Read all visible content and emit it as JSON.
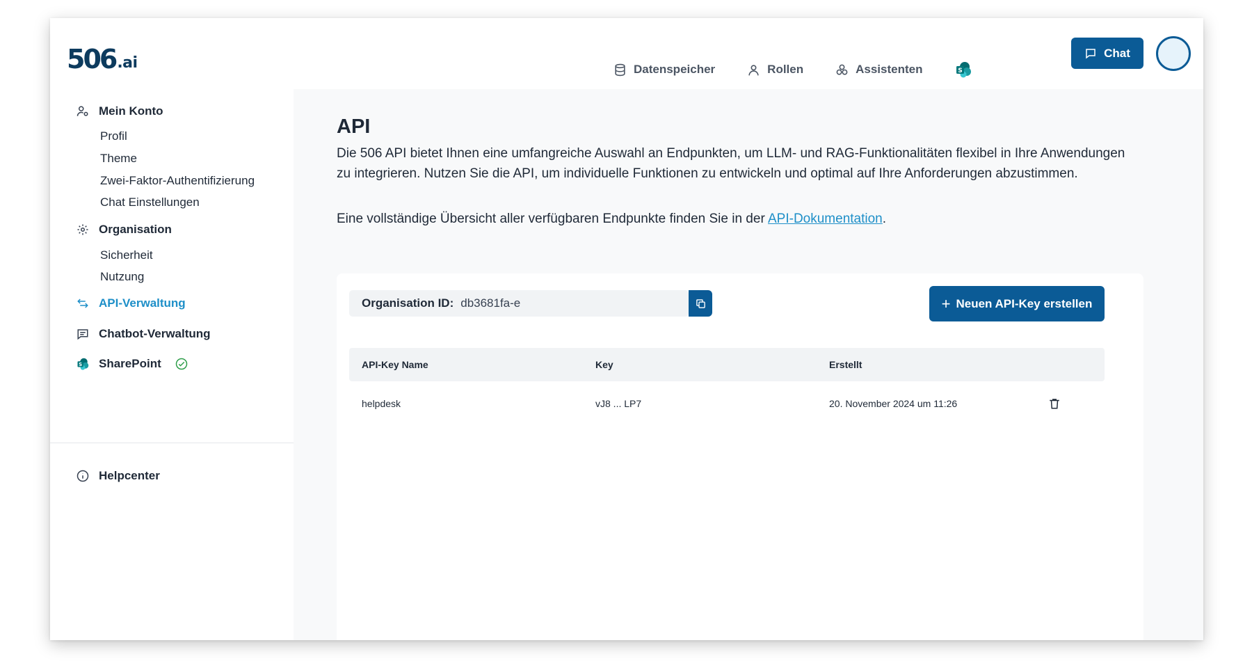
{
  "header": {
    "logo_number": "506",
    "logo_domain": ".ai",
    "nav": [
      {
        "label": "Datenspeicher",
        "icon": "database-icon"
      },
      {
        "label": "Rollen",
        "icon": "user-icon"
      },
      {
        "label": "Assistenten",
        "icon": "assistants-icon"
      }
    ],
    "sharepoint_icon": "sharepoint-icon",
    "chat_label": "Chat"
  },
  "sidebar": {
    "mein_konto": "Mein Konto",
    "profil": "Profil",
    "theme": "Theme",
    "zwei_faktor": "Zwei-Faktor-Authentifizierung",
    "chat_einstellungen": "Chat Einstellungen",
    "organisation": "Organisation",
    "sicherheit": "Sicherheit",
    "nutzung": "Nutzung",
    "api_verwaltung": "API-Verwaltung",
    "chatbot_verwaltung": "Chatbot-Verwaltung",
    "sharepoint": "SharePoint",
    "helpcenter": "Helpcenter"
  },
  "main": {
    "title": "API",
    "description": "Die 506 API bietet Ihnen eine umfangreiche Auswahl an Endpunkten, um LLM- und RAG-Funktionalitäten flexibel in Ihre Anwendungen zu integrieren. Nutzen Sie die API, um individuelle Funktionen zu entwickeln und optimal auf Ihre Anforderungen abzustimmen.",
    "doc_prefix": "Eine vollständige Übersicht aller verfügbaren Endpunkte finden Sie in der ",
    "doc_link": "API-Dokumentation",
    "doc_suffix": ".",
    "org_label": "Organisation ID:",
    "org_value": "db3681fa-e",
    "new_key_label": "Neuen API-Key erstellen",
    "table": {
      "headers": [
        "API-Key Name",
        "Key",
        "Erstellt"
      ],
      "rows": [
        {
          "name": "helpdesk",
          "key": "vJ8 ... LP7",
          "created": "20. November 2024 um 11:26"
        }
      ]
    }
  },
  "colors": {
    "primary": "#0b5b96",
    "active_link": "#1e8fc8",
    "success": "#2e9e4a"
  }
}
